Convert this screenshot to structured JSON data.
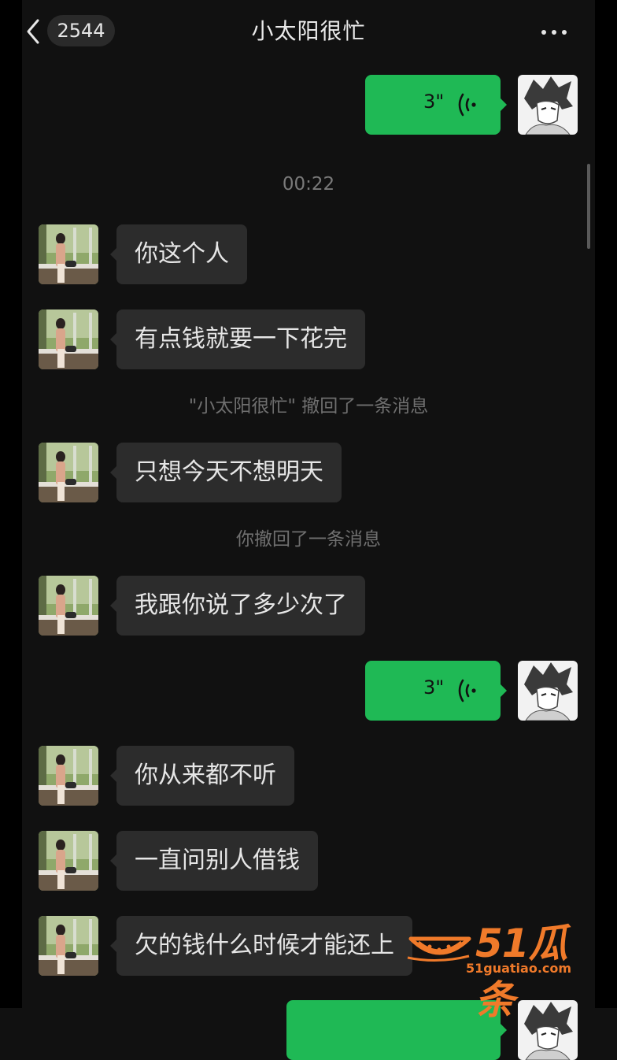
{
  "header": {
    "unread_count": "2544",
    "title": "小太阳很忙"
  },
  "messages": [
    {
      "kind": "voice",
      "duration": "3\""
    },
    {
      "kind": "time",
      "text": "00:22"
    },
    {
      "kind": "text",
      "text": "你这个人"
    },
    {
      "kind": "text",
      "text": "有点钱就要一下花完"
    },
    {
      "kind": "recall",
      "text": "\"小太阳很忙\" 撤回了一条消息"
    },
    {
      "kind": "text",
      "text": "只想今天不想明天"
    },
    {
      "kind": "recall",
      "text": "你撤回了一条消息"
    },
    {
      "kind": "text",
      "text": "我跟你说了多少次了"
    },
    {
      "kind": "voice",
      "duration": "3\""
    },
    {
      "kind": "text",
      "text": "你从来都不听"
    },
    {
      "kind": "text",
      "text": "一直问别人借钱"
    },
    {
      "kind": "text",
      "text": "欠的钱什么时候才能还上"
    }
  ],
  "watermark": {
    "title": "51瓜条",
    "site": "51guatiao.com"
  },
  "colors": {
    "background": "#111111",
    "incoming_bubble": "#2c2c2c",
    "outgoing_bubble": "#1fb955",
    "watermark": "#f07a2a"
  },
  "icons": [
    "back-chevron-icon",
    "more-dots-icon",
    "voice-wave-icon"
  ]
}
